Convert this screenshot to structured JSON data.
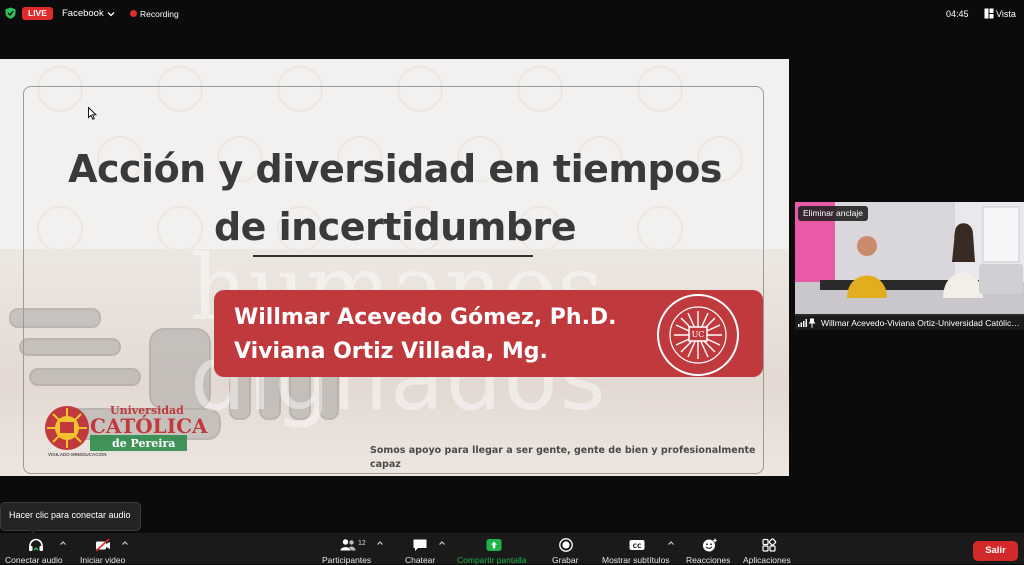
{
  "top_bar": {
    "live_badge": "LIVE",
    "stream_target": "Facebook",
    "recording_label": "Recording",
    "time": "04:45",
    "view_label": "Vista"
  },
  "slide": {
    "title": "Acción y diversidad en tiempos de incertidumbre",
    "authors": [
      "Willmar Acevedo Gómez, Ph.D.",
      "Viviana Ortiz Villada, Mg."
    ],
    "watermark_words": [
      "humanos",
      "dignados"
    ],
    "logo": {
      "line1": "Universidad",
      "line2": "CATÓLICA",
      "line3": "de Pereira",
      "subtitle": "VIGILADO MINEDUCACIÓN"
    },
    "seal_text": "UNIVERSIDAD CATÓLICA DE PEREIRA",
    "tagline": "Somos apoyo para llegar a ser gente, gente de bien y profesionalmente capaz"
  },
  "video_tile": {
    "unpin_label": "Eliminar anclaje",
    "participant_name": "Willmar Acevedo-Viviana Ortiz-Universidad Católica de Pereira"
  },
  "tooltip": {
    "text": "Hacer clic para conectar audio"
  },
  "toolbar": {
    "items": [
      {
        "label": "Conectar audio",
        "icon": "headphones-icon"
      },
      {
        "label": "Iniciar video",
        "icon": "video-off-icon"
      },
      {
        "label": "Participantes",
        "icon": "participants-icon",
        "count": "12"
      },
      {
        "label": "Chatear",
        "icon": "chat-icon"
      },
      {
        "label": "Compartir pantalla",
        "icon": "share-screen-icon"
      },
      {
        "label": "Grabar",
        "icon": "record-icon"
      },
      {
        "label": "Mostrar subtítulos",
        "icon": "cc-icon"
      },
      {
        "label": "Reacciones",
        "icon": "reactions-icon"
      },
      {
        "label": "Aplicaciones",
        "icon": "apps-icon"
      }
    ],
    "leave_label": "Salir"
  },
  "colors": {
    "accent_red": "#c0393d",
    "live_red": "#e02b2b",
    "share_green": "#1fb24a",
    "leave_red": "#d22a2a",
    "logo_green": "#2e8b4a"
  }
}
